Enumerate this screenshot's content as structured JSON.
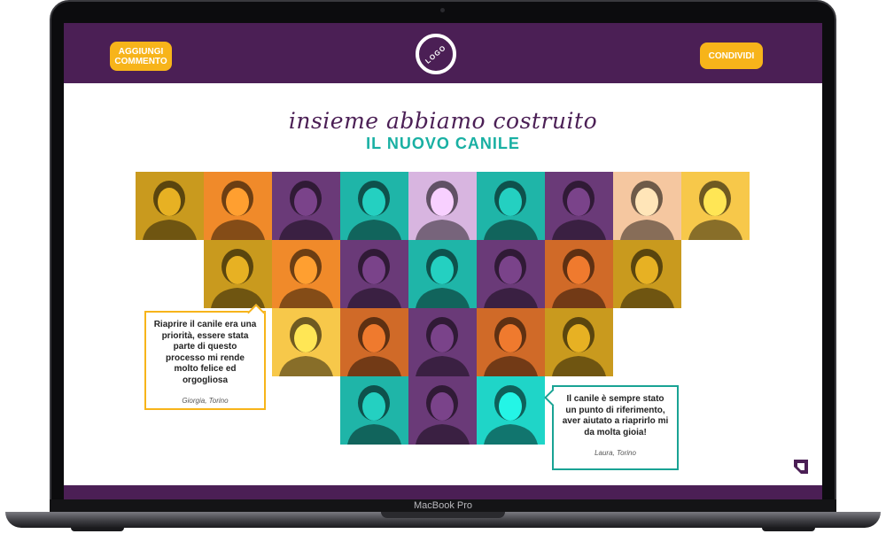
{
  "device": {
    "label": "MacBook Pro"
  },
  "header": {
    "add_comment_label": "AGGIUNGI COMMENTO",
    "share_label": "CONDIVIDI",
    "logo_text": "LOGO"
  },
  "hero": {
    "line1": "insieme abbiamo costruito",
    "line2": "IL NUOVO CANILE"
  },
  "testimonials": [
    {
      "text": "Riaprire il canile era una priorità, essere stata parte di questo processo mi rende molto felice ed orgogliosa",
      "author": "Giorgia, Torino"
    },
    {
      "text": "Il canile è sempre stato un punto di riferimento, aver aiutato a riaprirlo mi da molta gioia!",
      "author": "Laura, Torino"
    }
  ],
  "colors": {
    "purple": "#4b1f55",
    "yellow": "#f7b41a",
    "teal": "#19b0a3",
    "orange": "#f08a2a"
  },
  "portraits": [
    {
      "name": "portrait-1",
      "tint": "#c99a1e"
    },
    {
      "name": "portrait-2",
      "tint": "#f08a2a"
    },
    {
      "name": "portrait-3",
      "tint": "#6a3a78"
    },
    {
      "name": "portrait-4",
      "tint": "#1fb5a8"
    },
    {
      "name": "portrait-5",
      "tint": "#d8b5e0"
    },
    {
      "name": "portrait-6",
      "tint": "#1fb5a8"
    },
    {
      "name": "portrait-7",
      "tint": "#6a3a78"
    },
    {
      "name": "portrait-8",
      "tint": "#f5c7a0"
    },
    {
      "name": "portrait-9",
      "tint": "#f7c84a"
    },
    {
      "name": "portrait-10",
      "tint": "#c99a1e"
    },
    {
      "name": "portrait-11",
      "tint": "#f08a2a"
    },
    {
      "name": "portrait-12",
      "tint": "#6a3a78"
    },
    {
      "name": "portrait-13",
      "tint": "#1fb5a8"
    },
    {
      "name": "portrait-14",
      "tint": "#6a3a78"
    },
    {
      "name": "portrait-15",
      "tint": "#d06a28"
    },
    {
      "name": "portrait-16",
      "tint": "#c99a1e"
    },
    {
      "name": "portrait-17",
      "tint": "#f7c84a"
    },
    {
      "name": "portrait-18",
      "tint": "#d06a28"
    },
    {
      "name": "portrait-19",
      "tint": "#6a3a78"
    },
    {
      "name": "portrait-20",
      "tint": "#d06a28"
    },
    {
      "name": "portrait-21",
      "tint": "#c99a1e"
    },
    {
      "name": "portrait-22",
      "tint": "#1fb5a8"
    },
    {
      "name": "portrait-23",
      "tint": "#6a3a78"
    },
    {
      "name": "portrait-24",
      "tint": "#1fd5c8"
    }
  ]
}
